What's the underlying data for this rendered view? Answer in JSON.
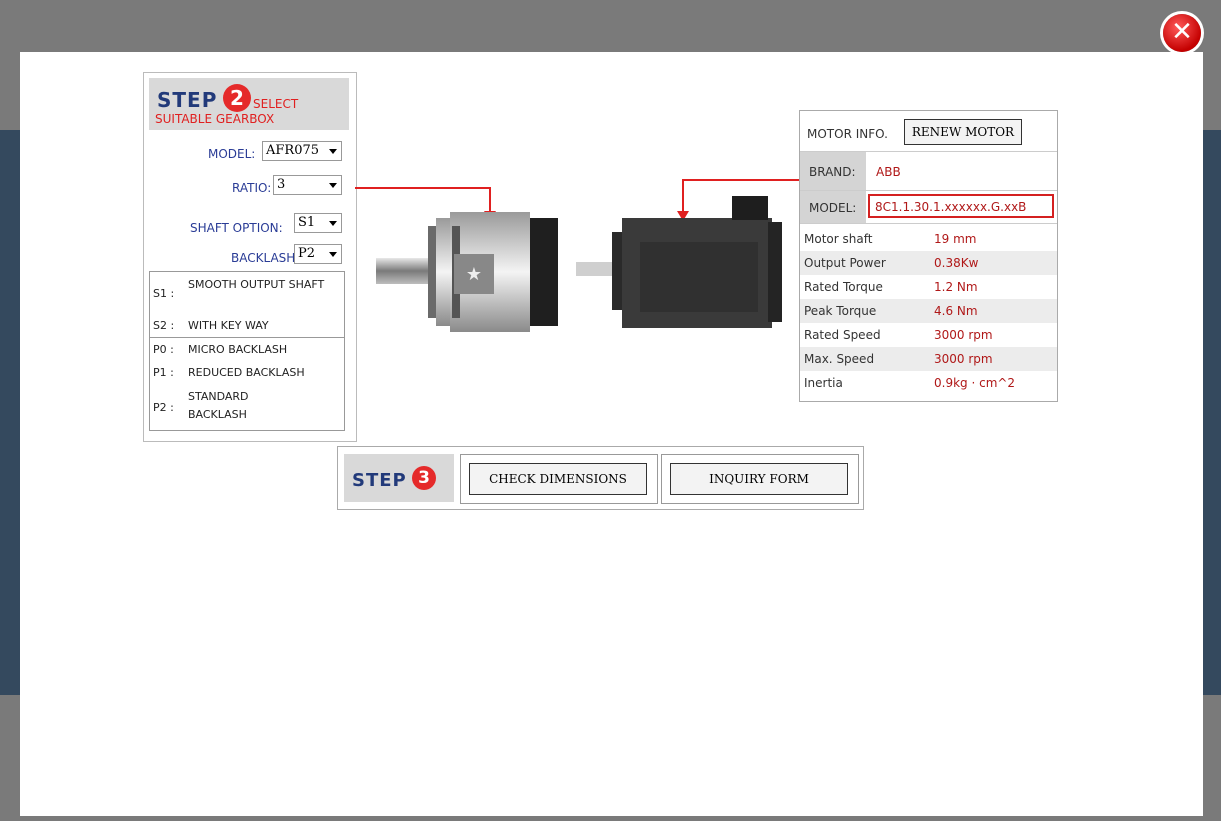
{
  "step2": {
    "step_word": "STEP",
    "step_number": "2",
    "subtitle_line1": "SELECT",
    "subtitle_line2": "SUITABLE GEARBOX",
    "model_label": "MODEL:",
    "model_value": "AFR075",
    "ratio_label": "RATIO:",
    "ratio_value": "3",
    "shaft_label": "SHAFT OPTION:",
    "shaft_value": "S1",
    "backlash_label": "BACKLASH:",
    "backlash_value": "P2",
    "legend": [
      {
        "code": "S1 :",
        "text": "SMOOTH OUTPUT SHAFT"
      },
      {
        "code": "S2 :",
        "text": "WITH KEY WAY"
      },
      {
        "code": "P0 :",
        "text": "MICRO BACKLASH"
      },
      {
        "code": "P1 :",
        "text": "REDUCED BACKLASH"
      },
      {
        "code": "P2 :",
        "text": "STANDARD BACKLASH"
      }
    ]
  },
  "motor": {
    "info_label": "MOTOR INFO.",
    "renew_button": "RENEW MOTOR",
    "brand_label": "BRAND:",
    "brand_value": "ABB",
    "model_label": "MODEL:",
    "model_value": "8C1.1.30.1.xxxxxx.G.xxB",
    "specs": [
      {
        "label": "Motor shaft",
        "value": "19 mm"
      },
      {
        "label": "Output Power",
        "value": "0.38Kw"
      },
      {
        "label": "Rated Torque",
        "value": "1.2 Nm"
      },
      {
        "label": "Peak Torque",
        "value": "4.6 Nm"
      },
      {
        "label": "Rated Speed",
        "value": "3000 rpm"
      },
      {
        "label": "Max. Speed",
        "value": "3000 rpm"
      },
      {
        "label": "Inertia",
        "value": "0.9kg · cm^2"
      }
    ]
  },
  "step3": {
    "step_word": "STEP",
    "step_number": "3",
    "check_dimensions": "CHECK DIMENSIONS",
    "inquiry_form": "INQUIRY FORM"
  },
  "colors": {
    "accent_red": "#e02020",
    "step_blue": "#223a7a",
    "value_red": "#b01818",
    "backdrop": "#34495e"
  },
  "icons": {
    "close": "close-x-icon",
    "gearbox": "gearbox-image",
    "motor": "servo-motor-image"
  }
}
